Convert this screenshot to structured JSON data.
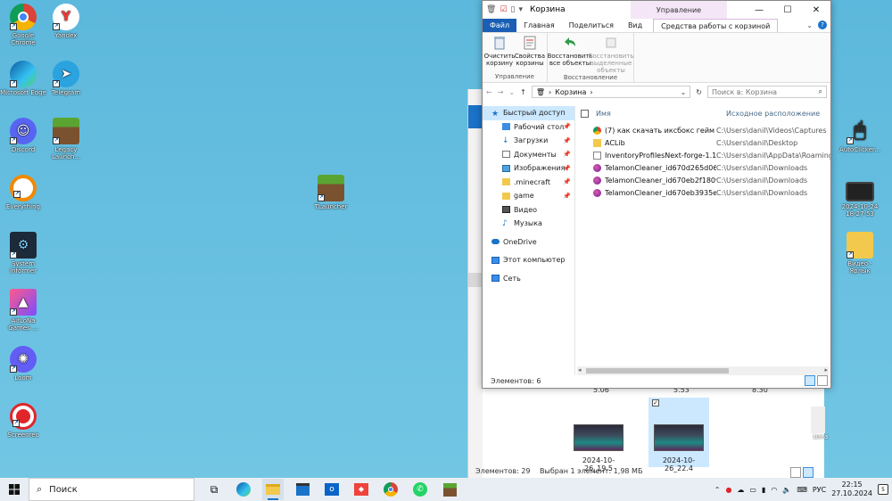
{
  "desktop": {
    "icons": [
      {
        "label": "Google Chrome"
      },
      {
        "label": "Yandex"
      },
      {
        "label": "Microsoft Edge"
      },
      {
        "label": "Telegram"
      },
      {
        "label": "Discord"
      },
      {
        "label": "Legacy Launch..."
      },
      {
        "label": "Everything"
      },
      {
        "label": "TLauncher"
      },
      {
        "label": "System Informer"
      },
      {
        "label": "AirLoNa Games ..."
      },
      {
        "label": "Loom"
      },
      {
        "label": "Screenrec"
      },
      {
        "label": "AutoClicker..."
      },
      {
        "label": "2024-10-24 18-27-53"
      },
      {
        "label": "Видео - Ярлык"
      }
    ]
  },
  "bg_window": {
    "numbers": [
      "5.06",
      "5.53",
      "8.30"
    ],
    "thumbs": [
      {
        "label": "2024-10-26_19.5"
      },
      {
        "label": "2024-10-26_22.4"
      }
    ],
    "status_count": "Элементов: 29",
    "status_selected": "Выбран 1 элемент: 1,98 МБ",
    "recycle_label": "зина"
  },
  "window": {
    "title": "Корзина",
    "context_header": "Управление",
    "tabs": {
      "file": "Файл",
      "home": "Главная",
      "share": "Поделиться",
      "view": "Вид",
      "context": "Средства работы с корзиной"
    },
    "ribbon": {
      "empty_bin": "Очистить корзину",
      "properties": "Свойства корзины",
      "group_manage": "Управление",
      "restore_all": "Восстановить все объекты",
      "restore_selected": "Восстановить выделенные объекты",
      "group_restore": "Восстановление"
    },
    "address": {
      "path": "Корзина",
      "search_placeholder": "Поиск в: Корзина"
    },
    "nav": {
      "quick_access": "Быстрый доступ",
      "desktop": "Рабочий стол",
      "downloads": "Загрузки",
      "documents": "Документы",
      "pictures": "Изображения",
      "minecraft": ".minecraft",
      "game": "game",
      "video": "Видео",
      "music": "Музыка",
      "onedrive": "OneDrive",
      "this_pc": "Этот компьютер",
      "network": "Сеть"
    },
    "columns": {
      "name": "Имя",
      "location": "Исходное расположение"
    },
    "files": [
      {
        "name": "(7) как скачать иксбокс гейм б...",
        "location": "C:\\Users\\danil\\Videos\\Captures",
        "icon": "chrome-file"
      },
      {
        "name": "ACLib",
        "location": "C:\\Users\\danil\\Desktop",
        "icon": "folder"
      },
      {
        "name": "InventoryProfilesNext-forge-1.1...",
        "location": "C:\\Users\\danil\\AppData\\Roaming\\.m",
        "icon": "jar-file"
      },
      {
        "name": "TelamonCleaner_id670d265d06...",
        "location": "C:\\Users\\danil\\Downloads",
        "icon": "telamon"
      },
      {
        "name": "TelamonCleaner_id670eb2f1809...",
        "location": "C:\\Users\\danil\\Downloads",
        "icon": "telamon"
      },
      {
        "name": "TelamonCleaner_id670eb3935e...",
        "location": "C:\\Users\\danil\\Downloads",
        "icon": "telamon"
      }
    ],
    "status": "Элементов: 6"
  },
  "taskbar": {
    "search": "Поиск",
    "lang": "РУС",
    "time": "22:15",
    "date": "27.10.2024",
    "notifications": "5"
  },
  "colors": {
    "accent": "#1a5fb4",
    "selection": "#cce8ff",
    "desktop": "#6fc2df"
  }
}
